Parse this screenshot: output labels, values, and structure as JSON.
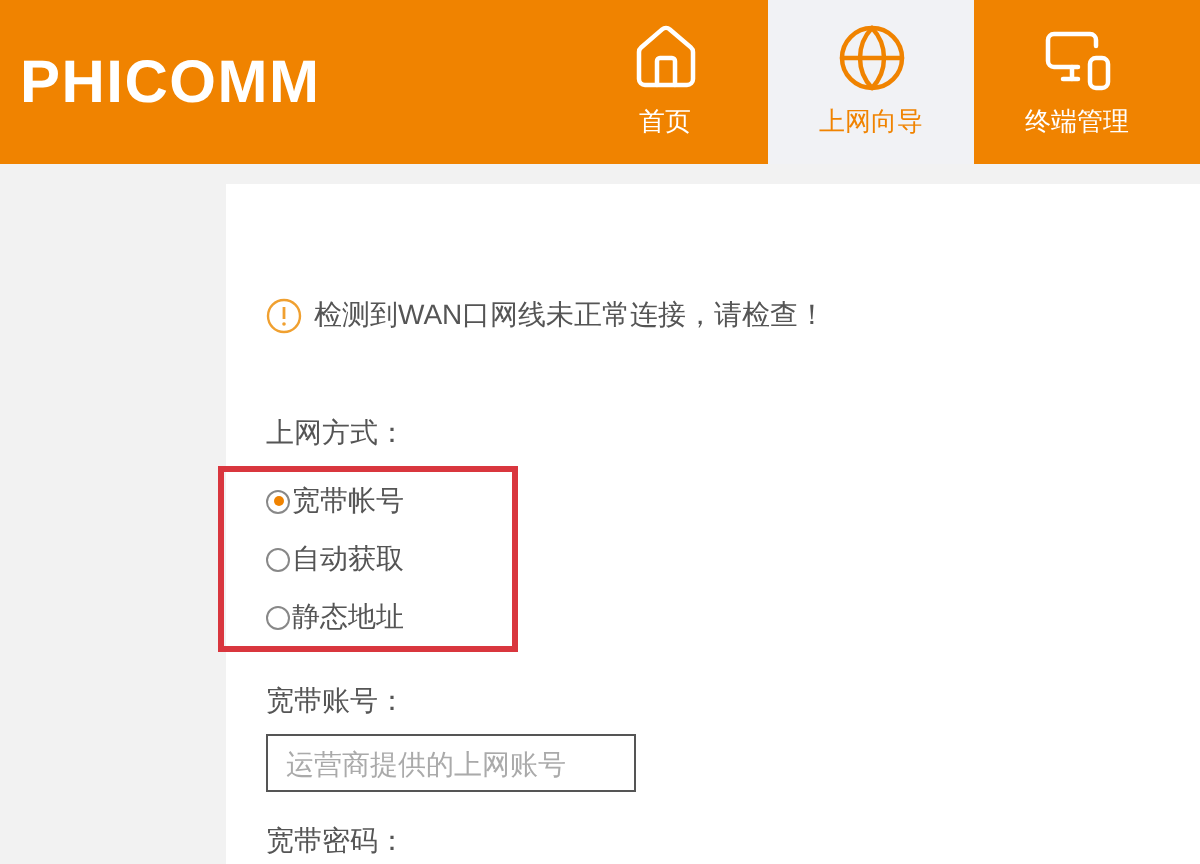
{
  "header": {
    "logo": "PHICOMM",
    "nav": [
      {
        "label": "首页",
        "kind": "home",
        "selected": false
      },
      {
        "label": "上网向导",
        "kind": "wizard",
        "selected": true
      },
      {
        "label": "终端管理",
        "kind": "devices",
        "selected": false
      }
    ]
  },
  "warning": "检测到WAN口网线未正常连接，请检查！",
  "connection": {
    "label": "上网方式：",
    "options": [
      {
        "label": "宽带帐号",
        "selected": true
      },
      {
        "label": "自动获取",
        "selected": false
      },
      {
        "label": "静态地址",
        "selected": false
      }
    ]
  },
  "account": {
    "label": "宽带账号：",
    "placeholder": "运营商提供的上网账号"
  },
  "password": {
    "label": "宽带密码："
  }
}
